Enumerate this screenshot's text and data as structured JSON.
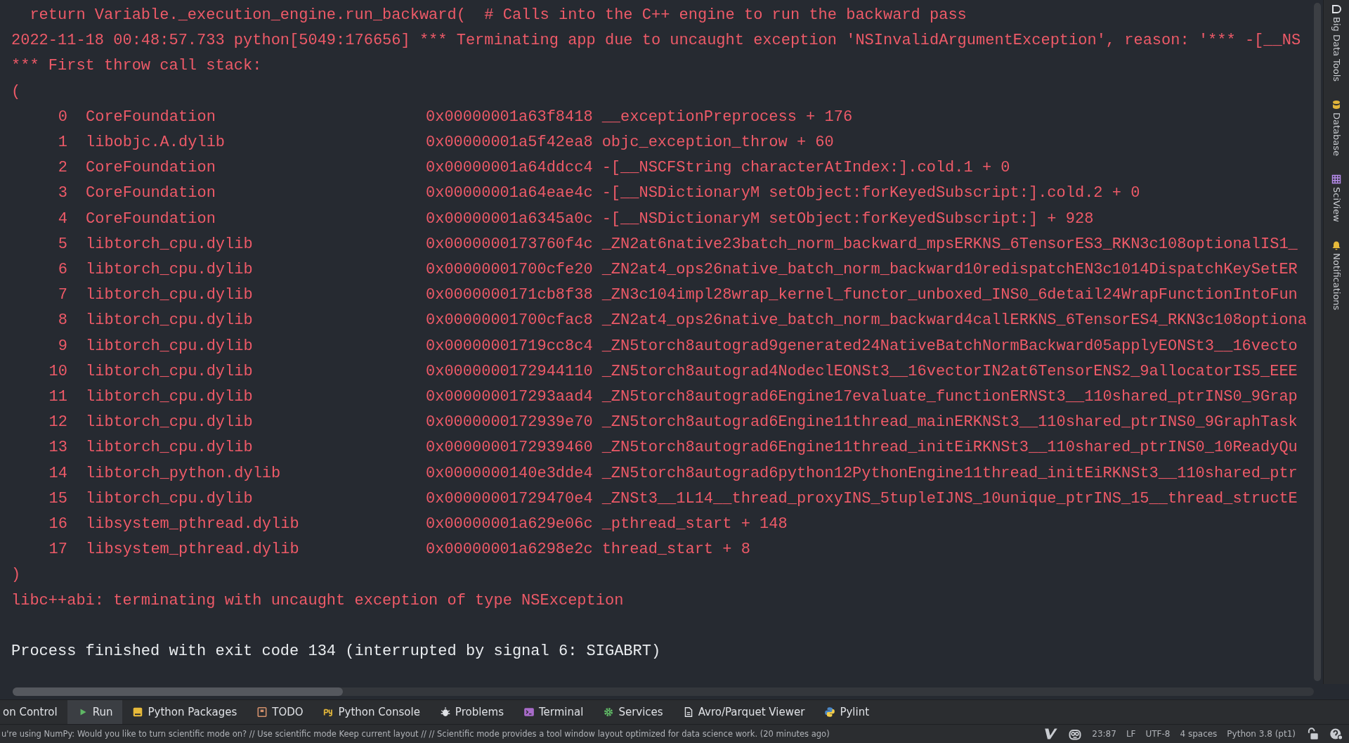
{
  "console": {
    "lines_before": [
      {
        "kind": "error",
        "text": "  return Variable._execution_engine.run_backward(  # Calls into the C++ engine to run the backward pass"
      },
      {
        "kind": "error",
        "text": "2022-11-18 00:48:57.733 python[5049:176656] *** Terminating app due to uncaught exception 'NSInvalidArgumentException', reason: '*** -[__NS"
      },
      {
        "kind": "error",
        "text": "*** First throw call stack:"
      },
      {
        "kind": "error",
        "text": "("
      }
    ],
    "frames": [
      {
        "index": "0",
        "library": "CoreFoundation",
        "address": "0x00000001a63f8418",
        "symbol": "__exceptionPreprocess + 176"
      },
      {
        "index": "1",
        "library": "libobjc.A.dylib",
        "address": "0x00000001a5f42ea8",
        "symbol": "objc_exception_throw + 60"
      },
      {
        "index": "2",
        "library": "CoreFoundation",
        "address": "0x00000001a64ddcc4",
        "symbol": "-[__NSCFString characterAtIndex:].cold.1 + 0"
      },
      {
        "index": "3",
        "library": "CoreFoundation",
        "address": "0x00000001a64eae4c",
        "symbol": "-[__NSDictionaryM setObject:forKeyedSubscript:].cold.2 + 0"
      },
      {
        "index": "4",
        "library": "CoreFoundation",
        "address": "0x00000001a6345a0c",
        "symbol": "-[__NSDictionaryM setObject:forKeyedSubscript:] + 928"
      },
      {
        "index": "5",
        "library": "libtorch_cpu.dylib",
        "address": "0x0000000173760f4c",
        "symbol": "_ZN2at6native23batch_norm_backward_mpsERKNS_6TensorES3_RKN3c108optionalIS1_"
      },
      {
        "index": "6",
        "library": "libtorch_cpu.dylib",
        "address": "0x00000001700cfe20",
        "symbol": "_ZN2at4_ops26native_batch_norm_backward10redispatchEN3c1014DispatchKeySetER"
      },
      {
        "index": "7",
        "library": "libtorch_cpu.dylib",
        "address": "0x0000000171cb8f38",
        "symbol": "_ZN3c104impl28wrap_kernel_functor_unboxed_INS0_6detail24WrapFunctionIntoFun"
      },
      {
        "index": "8",
        "library": "libtorch_cpu.dylib",
        "address": "0x00000001700cfac8",
        "symbol": "_ZN2at4_ops26native_batch_norm_backward4callERKNS_6TensorES4_RKN3c108optiona"
      },
      {
        "index": "9",
        "library": "libtorch_cpu.dylib",
        "address": "0x00000001719cc8c4",
        "symbol": "_ZN5torch8autograd9generated24NativeBatchNormBackward05applyEONSt3__16vecto"
      },
      {
        "index": "10",
        "library": "libtorch_cpu.dylib",
        "address": "0x0000000172944110",
        "symbol": "_ZN5torch8autograd4NodeclEONSt3__16vectorIN2at6TensorENS2_9allocatorIS5_EEE"
      },
      {
        "index": "11",
        "library": "libtorch_cpu.dylib",
        "address": "0x000000017293aad4",
        "symbol": "_ZN5torch8autograd6Engine17evaluate_functionERNSt3__110shared_ptrINS0_9Grap"
      },
      {
        "index": "12",
        "library": "libtorch_cpu.dylib",
        "address": "0x0000000172939e70",
        "symbol": "_ZN5torch8autograd6Engine11thread_mainERKNSt3__110shared_ptrINS0_9GraphTask"
      },
      {
        "index": "13",
        "library": "libtorch_cpu.dylib",
        "address": "0x0000000172939460",
        "symbol": "_ZN5torch8autograd6Engine11thread_initEiRKNSt3__110shared_ptrINS0_10ReadyQu"
      },
      {
        "index": "14",
        "library": "libtorch_python.dylib",
        "address": "0x0000000140e3dde4",
        "symbol": "_ZN5torch8autograd6python12PythonEngine11thread_initEiRKNSt3__110shared_ptr"
      },
      {
        "index": "15",
        "library": "libtorch_cpu.dylib",
        "address": "0x00000001729470e4",
        "symbol": "_ZNSt3__1L14__thread_proxyINS_5tupleIJNS_10unique_ptrINS_15__thread_structE"
      },
      {
        "index": "16",
        "library": "libsystem_pthread.dylib",
        "address": "0x00000001a629e06c",
        "symbol": "_pthread_start + 148"
      },
      {
        "index": "17",
        "library": "libsystem_pthread.dylib",
        "address": "0x00000001a6298e2c",
        "symbol": "thread_start + 8"
      }
    ],
    "lines_after": [
      {
        "kind": "error",
        "text": ")"
      },
      {
        "kind": "error",
        "text": "libc++abi: terminating with uncaught exception of type NSException"
      },
      {
        "kind": "info",
        "text": "Process finished with exit code 134 (interrupted by signal 6: SIGABRT)"
      }
    ]
  },
  "sidebar": {
    "items": [
      {
        "label": "Big Data Tools"
      },
      {
        "label": "Database"
      },
      {
        "label": "SciView"
      },
      {
        "label": "Notifications"
      }
    ]
  },
  "tool_tabs": [
    {
      "label": "on Control",
      "selected": false
    },
    {
      "label": "Run",
      "selected": true
    },
    {
      "label": "Python Packages",
      "selected": false
    },
    {
      "label": "TODO",
      "selected": false
    },
    {
      "label": "Python Console",
      "selected": false
    },
    {
      "label": "Problems",
      "selected": false
    },
    {
      "label": "Terminal",
      "selected": false
    },
    {
      "label": "Services",
      "selected": false
    },
    {
      "label": "Avro/Parquet Viewer",
      "selected": false
    },
    {
      "label": "Pylint",
      "selected": false
    }
  ],
  "status_bar": {
    "message": "u're using NumPy: Would you like to turn scientific mode on? // Use scientific mode   Keep current layout // // Scientific mode provides a tool window layout optimized for data science work. (20 minutes ago)",
    "items": [
      "23:87",
      "LF",
      "UTF-8",
      "4 spaces",
      "Python 3.8 (pt1)"
    ]
  }
}
